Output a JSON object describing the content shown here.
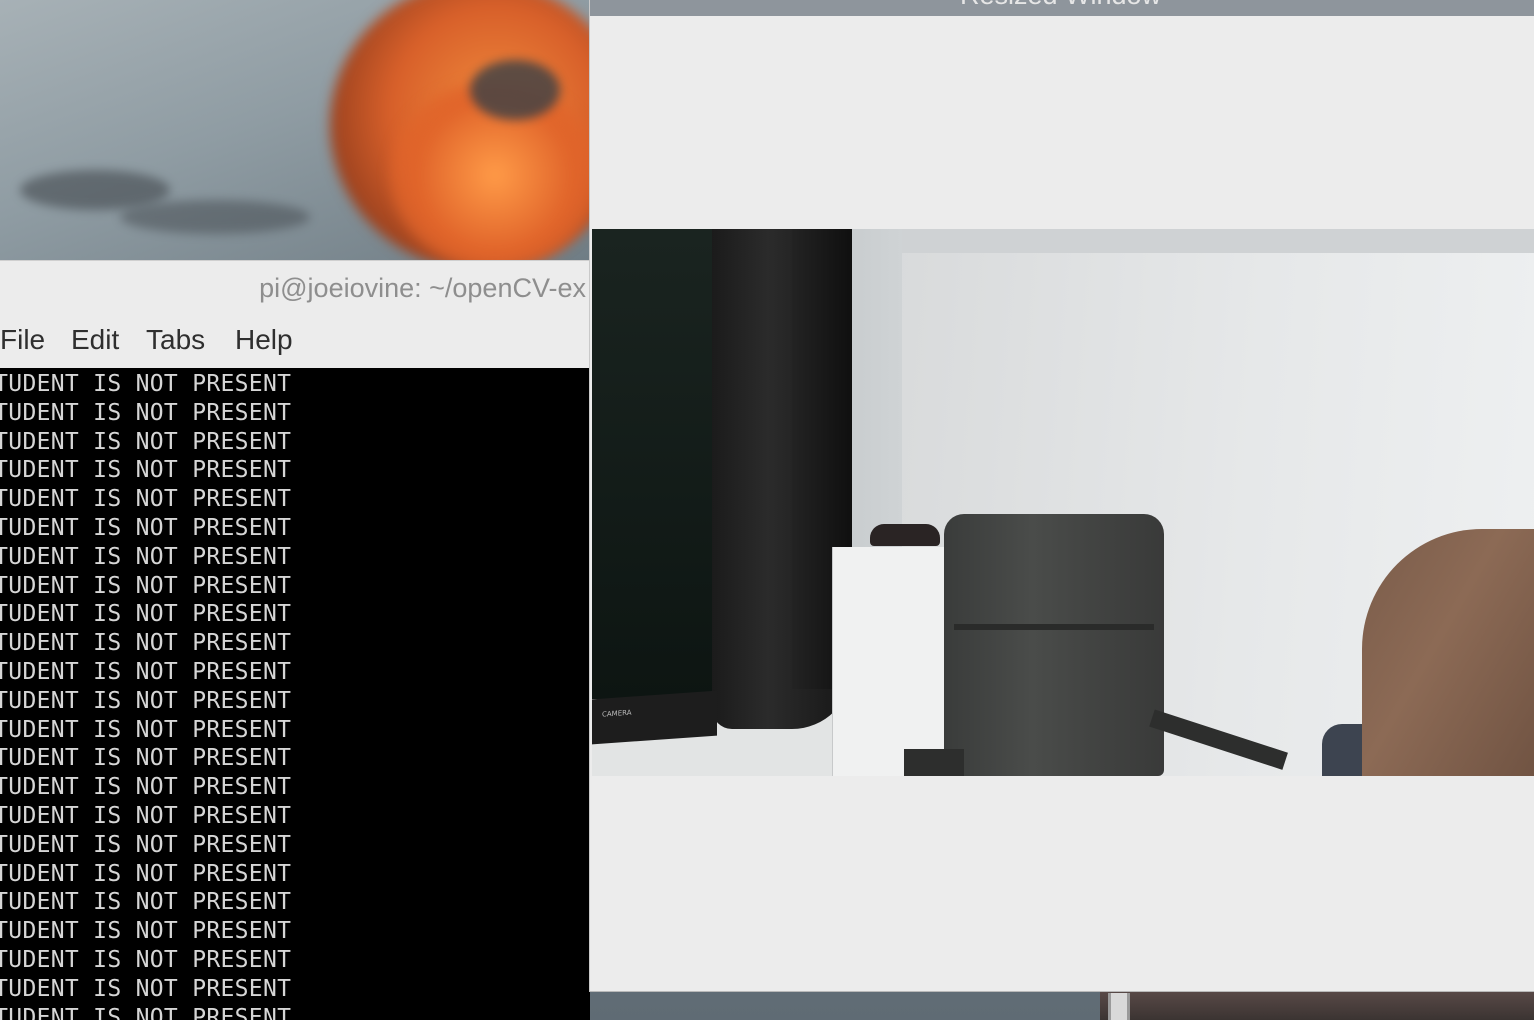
{
  "terminal": {
    "title": "pi@joeiovine: ~/openCV-ex",
    "menu": [
      "File",
      "Edit",
      "Tabs",
      "Help"
    ],
    "output_lines": [
      "STUDENT IS NOT PRESENT",
      "STUDENT IS NOT PRESENT",
      "STUDENT IS NOT PRESENT",
      "STUDENT IS NOT PRESENT",
      "STUDENT IS NOT PRESENT",
      "STUDENT IS NOT PRESENT",
      "STUDENT IS NOT PRESENT",
      "STUDENT IS NOT PRESENT",
      "STUDENT IS NOT PRESENT",
      "STUDENT IS NOT PRESENT",
      "STUDENT IS NOT PRESENT",
      "STUDENT IS NOT PRESENT",
      "STUDENT IS NOT PRESENT",
      "STUDENT IS NOT PRESENT",
      "STUDENT IS NOT PRESENT",
      "STUDENT IS NOT PRESENT",
      "STUDENT IS NOT PRESENT",
      "STUDENT IS NOT PRESENT",
      "STUDENT IS NOT PRESENT",
      "STUDENT IS NOT PRESENT",
      "STUDENT IS NOT PRESENT",
      "STUDENT IS NOT PRESENT",
      "STUDENT IS NOT PRESENT"
    ]
  },
  "cv_window": {
    "title": "Resized Window",
    "camera_box_label": "CAMERA"
  }
}
